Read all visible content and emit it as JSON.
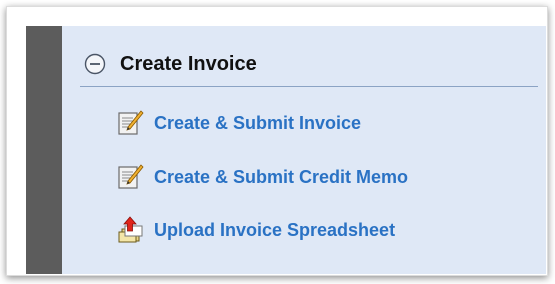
{
  "section": {
    "title": "Create Invoice",
    "collapse_icon": "collapse-minus-icon"
  },
  "menu": {
    "items": [
      {
        "label": "Create & Submit Invoice",
        "icon": "edit-document-icon"
      },
      {
        "label": "Create & Submit Credit Memo",
        "icon": "edit-document-icon"
      },
      {
        "label": "Upload Invoice Spreadsheet",
        "icon": "upload-documents-icon"
      }
    ]
  },
  "colors": {
    "panel_bg": "#dfe8f6",
    "side_strip": "#5c5c5c",
    "link_text": "#2a72c4",
    "header_divider": "#8ba3c4"
  }
}
